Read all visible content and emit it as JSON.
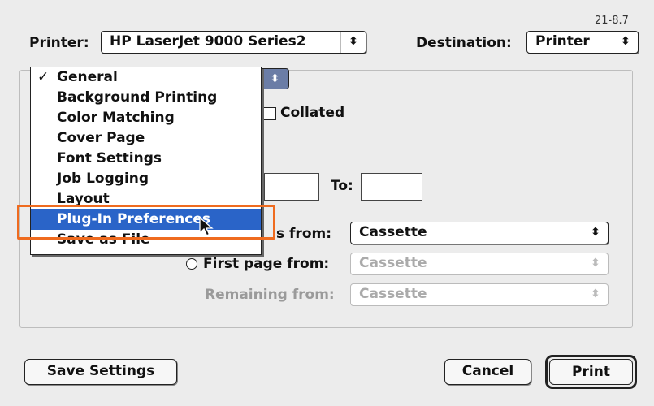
{
  "version_code": "21-8.7",
  "printer": {
    "label": "Printer:",
    "value": "HP LaserJet 9000 Series2"
  },
  "destination": {
    "label": "Destination:",
    "value": "Printer"
  },
  "panel_menu": {
    "items": [
      {
        "label": "General",
        "checked": true
      },
      {
        "label": "Background Printing"
      },
      {
        "label": "Color Matching"
      },
      {
        "label": "Cover Page"
      },
      {
        "label": "Font Settings"
      },
      {
        "label": "Job Logging"
      },
      {
        "label": "Layout"
      },
      {
        "label": "Plug-In Preferences",
        "highlighted": true
      },
      {
        "label": "Save as File"
      }
    ],
    "check_glyph": "✓"
  },
  "general": {
    "collated_label": "Collated",
    "to_label": "To:",
    "all_pages_from_label": "s from:",
    "all_pages_source": "Cassette",
    "first_page_label": "First page from:",
    "first_page_source": "Cassette",
    "remaining_label": "Remaining from:",
    "remaining_source": "Cassette"
  },
  "buttons": {
    "save_settings": "Save Settings",
    "cancel": "Cancel",
    "print": "Print"
  },
  "glyphs": {
    "updown": "⬍"
  },
  "colors": {
    "highlight": "#2a64c8",
    "annotation": "#ef6b1f"
  }
}
